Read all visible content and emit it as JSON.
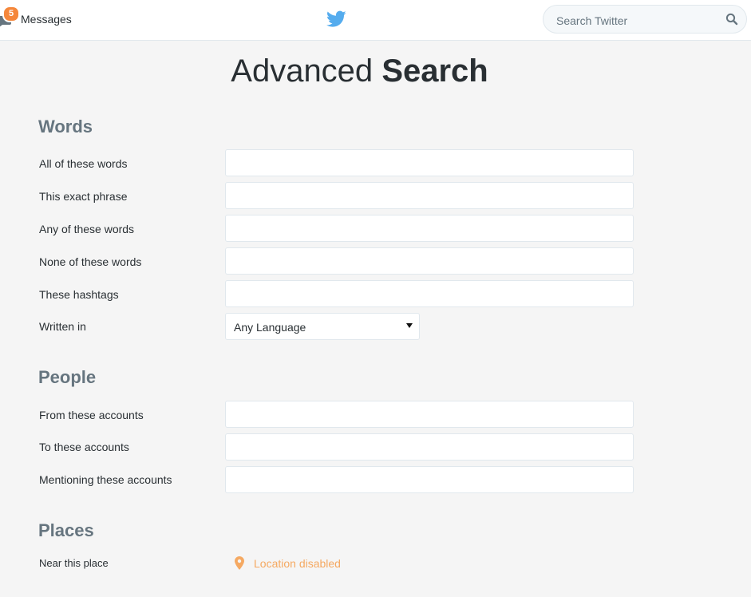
{
  "topbar": {
    "messages_label": "Messages",
    "messages_badge": "5",
    "badge_color": "#f5873b",
    "brand_color": "#55acee",
    "search_placeholder": "Search Twitter",
    "icons": [
      "messages-icon",
      "twitter-bird-icon",
      "search-icon"
    ]
  },
  "page": {
    "title_light": "Advanced",
    "title_bold": "Search"
  },
  "words": {
    "heading": "Words",
    "all_label": "All of these words",
    "all_value": "",
    "exact_label": "This exact phrase",
    "exact_value": "",
    "any_label": "Any of these words",
    "any_value": "",
    "none_label": "None of these words",
    "none_value": "",
    "hashtags_label": "These hashtags",
    "hashtags_value": "",
    "language_label": "Written in",
    "language_value": "Any Language"
  },
  "people": {
    "heading": "People",
    "from_label": "From these accounts",
    "from_value": "",
    "to_label": "To these accounts",
    "to_value": "",
    "mentioning_label": "Mentioning these accounts",
    "mentioning_value": ""
  },
  "places": {
    "heading": "Places",
    "near_label": "Near this place",
    "location_status": "Location disabled",
    "location_color": "#f5a962",
    "icon": "map-pin-icon"
  }
}
